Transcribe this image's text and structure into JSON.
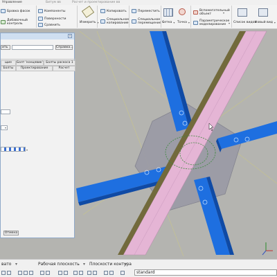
{
  "tabs": [
    "Управление",
    "Битум вв",
    "Расчет и проектирование вв"
  ],
  "ribbon": {
    "col1": [
      "Бровка фасок",
      "Добавочный контроль"
    ],
    "col2": [
      "Компоненты",
      "Поверхности",
      "Сравнить"
    ],
    "measure": "Измерить",
    "col4": [
      "Копировать",
      "Специальное копирование"
    ],
    "col5": [
      "Переместить",
      "Специальное перемещение"
    ],
    "grid": "Сетка",
    "points": "Точка",
    "col8": [
      "Вспомогательный объект",
      "Параметрическое моделирование"
    ],
    "views": [
      "Список видов",
      "Новый вид"
    ]
  },
  "dialog": {
    "apply_label": "ить",
    "help_button": "Справка...",
    "tab_headers": [
      "щие",
      "Болт 'концевик'",
      "Болты раскоса 1"
    ],
    "sub_headers": [
      "Болты",
      "Проектирование",
      "Расчет"
    ],
    "cancel_button": "Отмена"
  },
  "statusbar": {
    "snap_label": "вато",
    "work_plane": "Рабочая плоскость",
    "contour_planes": "Плоскости контура",
    "profile": "standard"
  },
  "colors": {
    "beam_blue": "#1e6fe0",
    "chord_pink": "#e5b5d5",
    "plate_gray": "#9a9aa6",
    "background": "#b4b4b0"
  }
}
